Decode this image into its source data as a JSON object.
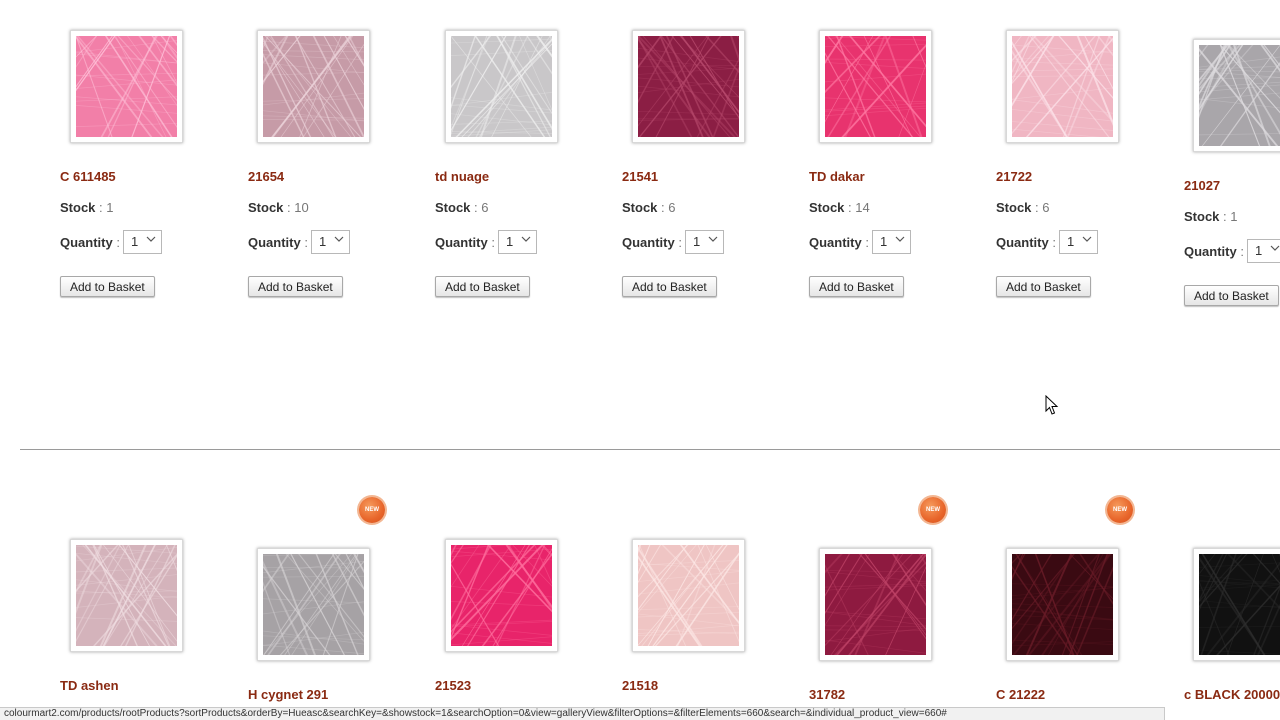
{
  "row1": [
    {
      "name": "C 611485",
      "stock_label": "Stock",
      "stock": "1",
      "qty_label": "Quantity",
      "qty": "1",
      "button": "Add to Basket",
      "color": "#f27fa8",
      "thread": "#ffc3da"
    },
    {
      "name": "21654",
      "stock_label": "Stock",
      "stock": "10",
      "qty_label": "Quantity",
      "qty": "1",
      "button": "Add to Basket",
      "color": "#c69ba7",
      "thread": "#ecd3da"
    },
    {
      "name": "td nuage",
      "stock_label": "Stock",
      "stock": "6",
      "qty_label": "Quantity",
      "qty": "1",
      "button": "Add to Basket",
      "color": "#c9c7c9",
      "thread": "#efefef"
    },
    {
      "name": "21541",
      "stock_label": "Stock",
      "stock": "6",
      "qty_label": "Quantity",
      "qty": "1",
      "button": "Add to Basket",
      "color": "#8b1e44",
      "thread": "#b84a6d"
    },
    {
      "name": "TD dakar",
      "stock_label": "Stock",
      "stock": "14",
      "qty_label": "Quantity",
      "qty": "1",
      "button": "Add to Basket",
      "color": "#e8336e",
      "thread": "#ff78a2"
    },
    {
      "name": "21722",
      "stock_label": "Stock",
      "stock": "6",
      "qty_label": "Quantity",
      "qty": "1",
      "button": "Add to Basket",
      "color": "#f0b6c3",
      "thread": "#fde3ea"
    },
    {
      "name": "21027",
      "stock_label": "Stock",
      "stock": "1",
      "qty_label": "Quantity",
      "qty": "1",
      "button": "Add to Basket",
      "color": "#a9a6aa",
      "thread": "#dedcdf"
    }
  ],
  "row2": [
    {
      "name": "TD ashen",
      "color": "#d4b3bb",
      "thread": "#f1dfe3",
      "is_new": false
    },
    {
      "name": "H cygnet 291",
      "color": "#a6a2a5",
      "thread": "#d7d4d6",
      "is_new": true
    },
    {
      "name": "21523",
      "color": "#e8246a",
      "thread": "#ff6f9e",
      "is_new": false
    },
    {
      "name": "21518",
      "color": "#efc5c4",
      "thread": "#fde8e6",
      "is_new": false
    },
    {
      "name": "31782",
      "color": "#8e1a40",
      "thread": "#c04468",
      "is_new": true
    },
    {
      "name": "C 21222",
      "color": "#3a0a12",
      "thread": "#6a1c28",
      "is_new": true
    },
    {
      "name": "c BLACK 20000",
      "color": "#111111",
      "thread": "#2e2e2e",
      "is_new": false
    }
  ],
  "badge_label": "NEW",
  "status_url": "colourmart2.com/products/rootProducts?sortProducts&orderBy=Hueasc&searchKey=&showstock=1&searchOption=0&view=galleryView&filterOptions=&filterElements=660&search=&individual_product_view=660#"
}
